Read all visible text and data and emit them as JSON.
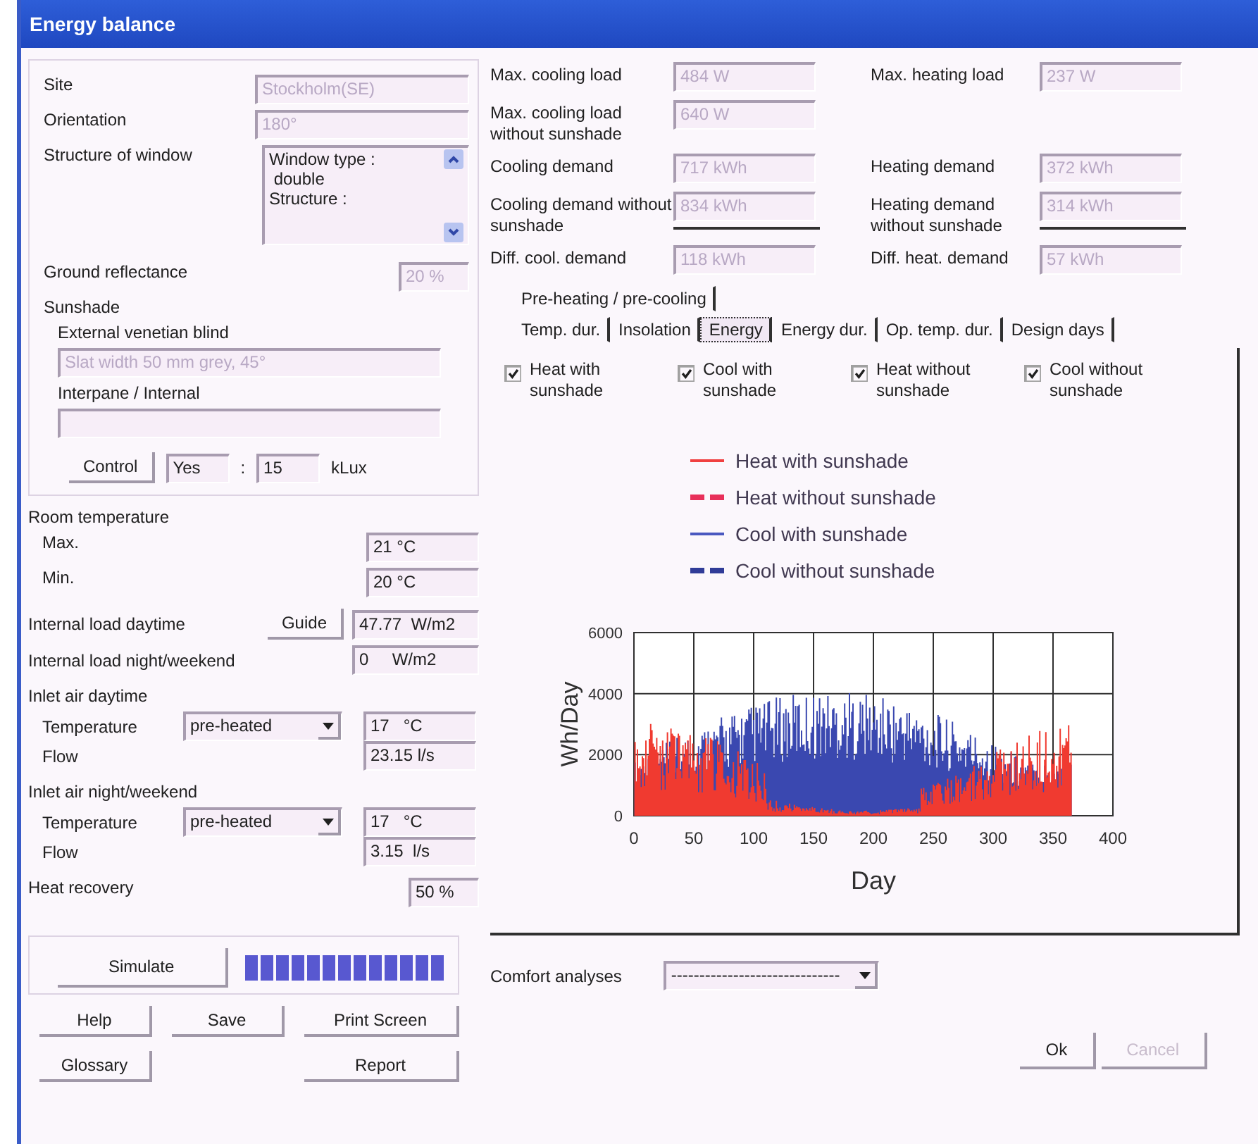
{
  "window": {
    "title": "Energy balance"
  },
  "site_group": {
    "rows": [
      {
        "label": "Site",
        "value": "Stockholm(SE)",
        "disabled": true
      },
      {
        "label": "Orientation",
        "value": "180°",
        "disabled": true
      }
    ],
    "structure": {
      "label": "Structure of window",
      "lines": [
        "Window type :",
        " double",
        "Structure :"
      ]
    },
    "ground_reflectance": {
      "label": "Ground reflectance",
      "value": "20 %",
      "disabled": true
    },
    "sunshade": {
      "label": "Sunshade",
      "blinds": [
        {
          "label": "External venetian blind",
          "value": "Slat width 50 mm grey, 45°",
          "disabled": true
        },
        {
          "label": "Interpane / Internal"
        }
      ]
    },
    "control": {
      "button": "Control",
      "mode": "Yes",
      "separator": ":",
      "value": "15",
      "unit": "kLux"
    }
  },
  "room_temperature": {
    "label": "Room temperature",
    "rows": [
      {
        "label": "Max.",
        "value": "21 °C"
      },
      {
        "label": "Min.",
        "value": "20 °C"
      }
    ]
  },
  "internal_load": [
    {
      "label": "Internal load daytime",
      "button": "Guide",
      "value": "47.77  W/m2"
    },
    {
      "label": "Internal load night/weekend",
      "value": "0     W/m2"
    }
  ],
  "inlet_air": [
    {
      "label": "Inlet air daytime",
      "temperature_label": "Temperature",
      "mode": "pre-heated",
      "temperature": "17   °C",
      "flow_label": "Flow",
      "flow": "23.15 l/s"
    },
    {
      "label": "Inlet air night/weekend",
      "temperature_label": "Temperature",
      "mode": "pre-heated",
      "temperature": "17   °C",
      "flow_label": "Flow",
      "flow": "3.15  l/s"
    }
  ],
  "heat_recovery": {
    "label": "Heat recovery",
    "value": "50 %"
  },
  "simulate": {
    "button": "Simulate",
    "level": 1
  },
  "buttons": [
    {
      "label": "Help"
    },
    {
      "label": "Save"
    },
    {
      "label": "Print Screen"
    },
    {
      "label": "Glossary"
    },
    {
      "label": "Report"
    }
  ],
  "results": {
    "rows": [
      {
        "cooling": {
          "label": "Max. cooling load",
          "value": "484 W"
        },
        "heating": {
          "label": "Max. heating load",
          "value": "237 W"
        },
        "underlined": false
      },
      {
        "cooling": {
          "label": "Max. cooling load without sunshade",
          "value": "640 W"
        },
        "underlined": false
      },
      {
        "cooling": {
          "label": "Cooling demand",
          "value": "717 kWh"
        },
        "heating": {
          "label": "Heating demand",
          "value": "372 kWh"
        },
        "underlined": false
      },
      {
        "cooling": {
          "label": "Cooling demand without sunshade",
          "value": "834 kWh"
        },
        "heating": {
          "label": "Heating demand without sunshade",
          "value": "314 kWh"
        },
        "underlined": true
      },
      {
        "cooling": {
          "label": "Diff. cool. demand",
          "value": "118 kWh"
        },
        "heating": {
          "label": "Diff. heat. demand",
          "value": "57 kWh"
        },
        "underlined": false
      }
    ]
  },
  "tabs": [
    [
      {
        "label": "Pre-heating / pre-cooling",
        "selected": false
      }
    ],
    [
      {
        "label": "Temp. dur.",
        "selected": false
      },
      {
        "label": "Insolation",
        "selected": false
      },
      {
        "label": "Energy",
        "selected": true
      },
      {
        "label": "Energy dur.",
        "selected": false
      },
      {
        "label": "Op. temp. dur.",
        "selected": false
      },
      {
        "label": "Design days",
        "selected": false
      }
    ]
  ],
  "series_toggles": [
    {
      "label": "Heat with sunshade",
      "checked": true
    },
    {
      "label": "Cool with sunshade",
      "checked": true
    },
    {
      "label": "Heat without sunshade",
      "checked": true
    },
    {
      "label": "Cool without sunshade",
      "checked": true
    }
  ],
  "legend": [
    {
      "label": "Heat with sunshade",
      "kind": "solid",
      "color": "#f04040"
    },
    {
      "label": "Heat without sunshade",
      "kind": "dashed",
      "color": "#e8305a"
    },
    {
      "label": "Cool with sunshade",
      "kind": "solid",
      "color": "#4a58c0"
    },
    {
      "label": "Cool without sunshade",
      "kind": "dashed",
      "color": "#303c98"
    }
  ],
  "plot": {
    "ylabel": "Wh/Day",
    "xlabel": "Day",
    "y_ticks": [
      "6000",
      "4000",
      "2000",
      "0"
    ],
    "x_ticks": [
      "0",
      "50",
      "100",
      "150",
      "200",
      "250",
      "300",
      "350",
      "400"
    ]
  },
  "comfort": {
    "label": "Comfort analyses",
    "value": "------------------------------"
  },
  "dialog_buttons": [
    {
      "label": "Ok",
      "disabled": false
    },
    {
      "label": "Cancel",
      "disabled": true
    }
  ]
}
